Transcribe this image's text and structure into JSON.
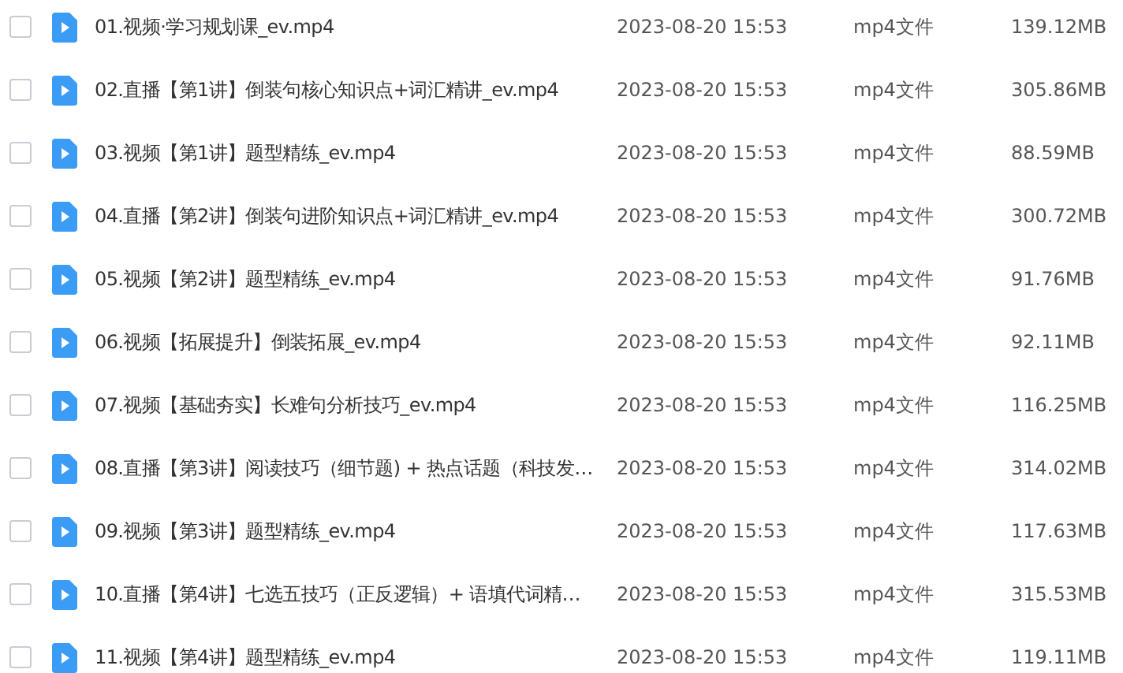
{
  "files": [
    {
      "checked": false,
      "name": "01.视频·学习规划课_ev.mp4",
      "modified": "2023-08-20 15:53",
      "type": "mp4文件",
      "size": "139.12MB"
    },
    {
      "checked": false,
      "name": "02.直播【第1讲】倒装句核心知识点+词汇精讲_ev.mp4",
      "modified": "2023-08-20 15:53",
      "type": "mp4文件",
      "size": "305.86MB"
    },
    {
      "checked": false,
      "name": "03.视频【第1讲】题型精练_ev.mp4",
      "modified": "2023-08-20 15:53",
      "type": "mp4文件",
      "size": "88.59MB"
    },
    {
      "checked": false,
      "name": "04.直播【第2讲】倒装句进阶知识点+词汇精讲_ev.mp4",
      "modified": "2023-08-20 15:53",
      "type": "mp4文件",
      "size": "300.72MB"
    },
    {
      "checked": false,
      "name": "05.视频【第2讲】题型精练_ev.mp4",
      "modified": "2023-08-20 15:53",
      "type": "mp4文件",
      "size": "91.76MB"
    },
    {
      "checked": false,
      "name": "06.视频【拓展提升】倒装拓展_ev.mp4",
      "modified": "2023-08-20 15:53",
      "type": "mp4文件",
      "size": "92.11MB"
    },
    {
      "checked": false,
      "name": "07.视频【基础夯实】长难句分析技巧_ev.mp4",
      "modified": "2023-08-20 15:53",
      "type": "mp4文件",
      "size": "116.25MB"
    },
    {
      "checked": false,
      "name": "08.直播【第3讲】阅读技巧（细节题) + 热点话题（科技发…",
      "modified": "2023-08-20 15:53",
      "type": "mp4文件",
      "size": "314.02MB"
    },
    {
      "checked": false,
      "name": "09.视频【第3讲】题型精练_ev.mp4",
      "modified": "2023-08-20 15:53",
      "type": "mp4文件",
      "size": "117.63MB"
    },
    {
      "checked": false,
      "name": "10.直播【第4讲】七选五技巧（正反逻辑）+ 语填代词精…",
      "modified": "2023-08-20 15:53",
      "type": "mp4文件",
      "size": "315.53MB"
    },
    {
      "checked": false,
      "name": "11.视频【第4讲】题型精练_ev.mp4",
      "modified": "2023-08-20 15:53",
      "type": "mp4文件",
      "size": "119.11MB"
    }
  ]
}
